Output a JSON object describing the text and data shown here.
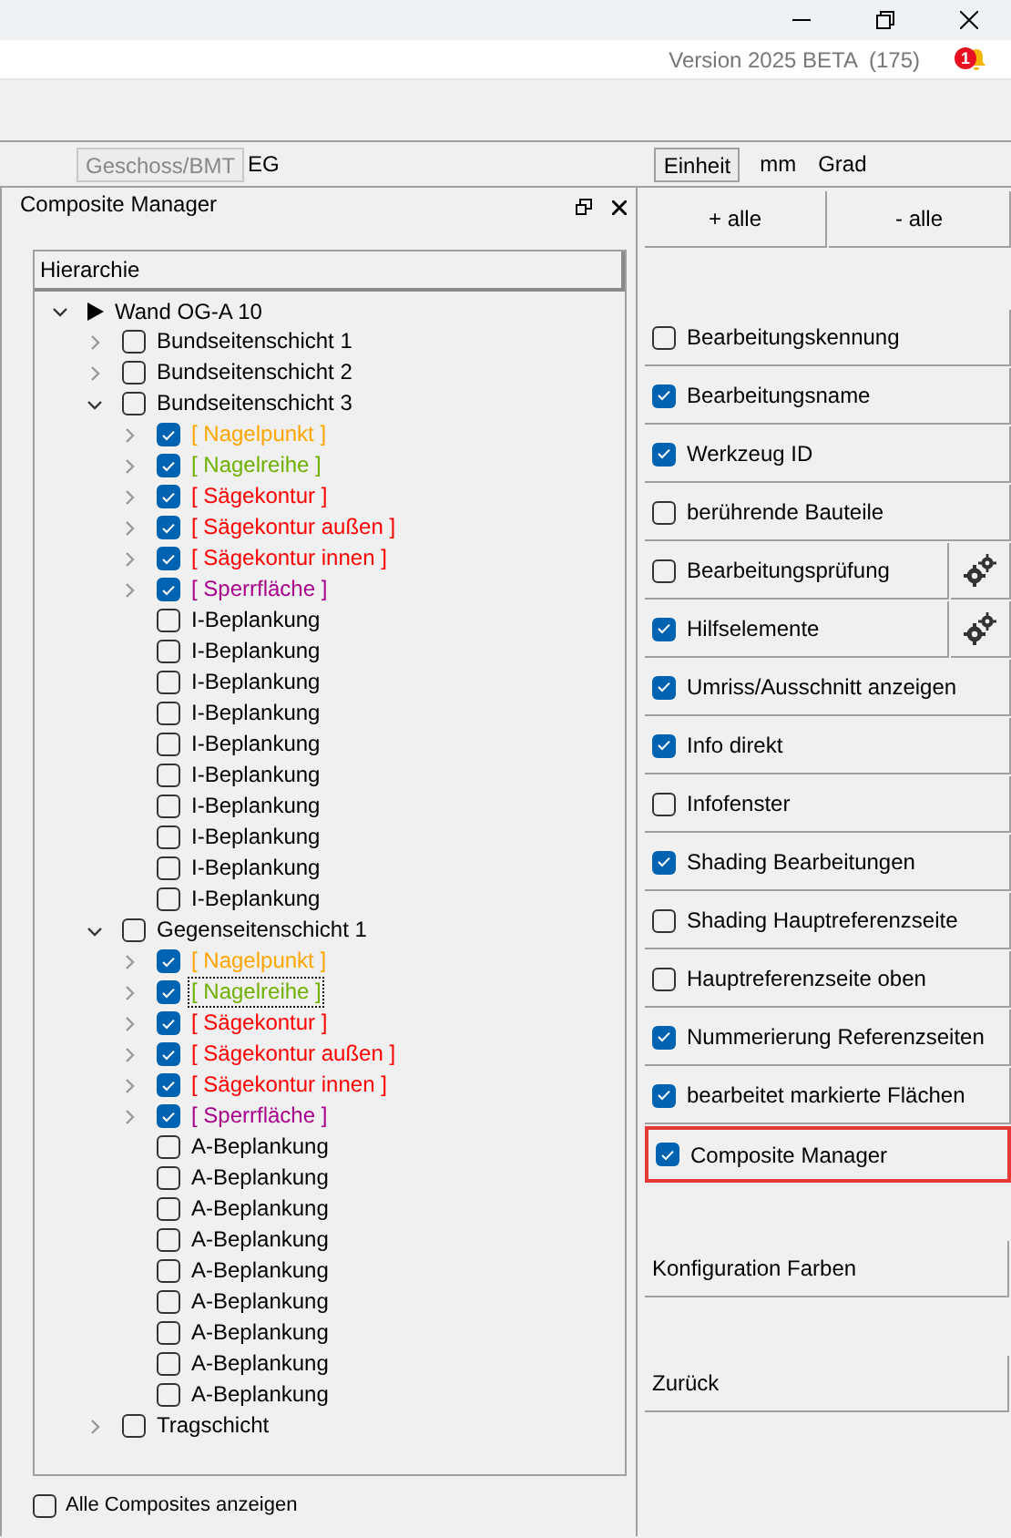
{
  "header": {
    "version": "Version 2025 BETA  (175)",
    "notification_count": "1"
  },
  "toolbar": {
    "floor_button": "Geschoss/BMT",
    "floor_value": "EG",
    "unit_button": "Einheit",
    "unit_length": "mm",
    "unit_angle": "Grad"
  },
  "composite_manager": {
    "title": "Composite Manager",
    "column_header": "Hierarchie",
    "tree": {
      "label": "Wand OG-A 10",
      "expanded": true,
      "children": [
        {
          "label": "Bundseitenschicht 1",
          "checked": false,
          "expanded": false
        },
        {
          "label": "Bundseitenschicht 2",
          "checked": false,
          "expanded": false
        },
        {
          "label": "Bundseitenschicht 3",
          "checked": false,
          "expanded": true,
          "children": [
            {
              "label": "[ Nagelpunkt ]",
              "checked": true,
              "expanded": false,
              "color": "#ffa500",
              "focused": false
            },
            {
              "label": "[ Nagelreihe ]",
              "checked": true,
              "expanded": false,
              "color": "#6fb000",
              "focused": false
            },
            {
              "label": "[ Sägekontur ]",
              "checked": true,
              "expanded": false,
              "color": "#ff0000",
              "focused": false
            },
            {
              "label": "[ Sägekontur außen ]",
              "checked": true,
              "expanded": false,
              "color": "#ff0000",
              "focused": false
            },
            {
              "label": "[ Sägekontur innen ]",
              "checked": true,
              "expanded": false,
              "color": "#ff0000",
              "focused": false
            },
            {
              "label": "[ Sperrfläche ]",
              "checked": true,
              "expanded": false,
              "color": "#a8008c",
              "focused": false
            },
            {
              "label": "I-Beplankung",
              "checked": false,
              "focused": false
            },
            {
              "label": "I-Beplankung",
              "checked": false,
              "focused": false
            },
            {
              "label": "I-Beplankung",
              "checked": false,
              "focused": false
            },
            {
              "label": "I-Beplankung",
              "checked": false,
              "focused": false
            },
            {
              "label": "I-Beplankung",
              "checked": false,
              "focused": false
            },
            {
              "label": "I-Beplankung",
              "checked": false,
              "focused": false
            },
            {
              "label": "I-Beplankung",
              "checked": false,
              "focused": false
            },
            {
              "label": "I-Beplankung",
              "checked": false,
              "focused": false
            },
            {
              "label": "I-Beplankung",
              "checked": false,
              "focused": false
            },
            {
              "label": "I-Beplankung",
              "checked": false,
              "focused": false
            }
          ]
        },
        {
          "label": "Gegenseitenschicht 1",
          "checked": false,
          "expanded": true,
          "children": [
            {
              "label": "[ Nagelpunkt ]",
              "checked": true,
              "expanded": false,
              "color": "#ffa500",
              "focused": false
            },
            {
              "label": "[ Nagelreihe ]",
              "checked": true,
              "expanded": false,
              "color": "#6fb000",
              "focused": true
            },
            {
              "label": "[ Sägekontur ]",
              "checked": true,
              "expanded": false,
              "color": "#ff0000",
              "focused": false
            },
            {
              "label": "[ Sägekontur außen ]",
              "checked": true,
              "expanded": false,
              "color": "#ff0000",
              "focused": false
            },
            {
              "label": "[ Sägekontur innen ]",
              "checked": true,
              "expanded": false,
              "color": "#ff0000",
              "focused": false
            },
            {
              "label": "[ Sperrfläche ]",
              "checked": true,
              "expanded": false,
              "color": "#a8008c",
              "focused": false
            },
            {
              "label": "A-Beplankung",
              "checked": false,
              "focused": false
            },
            {
              "label": "A-Beplankung",
              "checked": false,
              "focused": false
            },
            {
              "label": "A-Beplankung",
              "checked": false,
              "focused": false
            },
            {
              "label": "A-Beplankung",
              "checked": false,
              "focused": false
            },
            {
              "label": "A-Beplankung",
              "checked": false,
              "focused": false
            },
            {
              "label": "A-Beplankung",
              "checked": false,
              "focused": false
            },
            {
              "label": "A-Beplankung",
              "checked": false,
              "focused": false
            },
            {
              "label": "A-Beplankung",
              "checked": false,
              "focused": false
            },
            {
              "label": "A-Beplankung",
              "checked": false,
              "focused": false
            }
          ]
        },
        {
          "label": "Tragschicht",
          "checked": false,
          "expanded": false
        }
      ]
    },
    "show_all": {
      "label": "Alle Composites anzeigen",
      "checked": false
    }
  },
  "bulk_buttons": [
    "+ alle",
    "- alle"
  ],
  "options": [
    {
      "label": "Bearbeitungskennung",
      "checked": false,
      "kind": "plain",
      "highlighted": false
    },
    {
      "label": "Bearbeitungsname",
      "checked": true,
      "kind": "plain",
      "highlighted": false
    },
    {
      "label": "Werkzeug ID",
      "checked": true,
      "kind": "plain",
      "highlighted": false
    },
    {
      "label": "berührende Bauteile",
      "checked": false,
      "kind": "plain",
      "highlighted": false
    },
    {
      "label": "Bearbeitungsprüfung",
      "checked": false,
      "kind": "settings",
      "highlighted": false
    },
    {
      "label": "Hilfselemente",
      "checked": true,
      "kind": "settings",
      "highlighted": false
    },
    {
      "label": "Umriss/Ausschnitt anzeigen",
      "checked": true,
      "kind": "plain",
      "highlighted": false
    },
    {
      "label": "Info direkt",
      "checked": true,
      "kind": "plain",
      "highlighted": false
    },
    {
      "label": "Infofenster",
      "checked": false,
      "kind": "plain",
      "highlighted": false
    },
    {
      "label": "Shading Bearbeitungen",
      "checked": true,
      "kind": "plain",
      "highlighted": false
    },
    {
      "label": "Shading Hauptreferenzseite",
      "checked": false,
      "kind": "plain",
      "highlighted": false
    },
    {
      "label": "Hauptreferenzseite oben",
      "checked": false,
      "kind": "plain",
      "highlighted": false
    },
    {
      "label": "Nummerierung Referenzseiten",
      "checked": true,
      "kind": "plain",
      "highlighted": false
    },
    {
      "label": "bearbeitet markierte Flächen",
      "checked": true,
      "kind": "plain",
      "highlighted": false
    },
    {
      "label": "Composite Manager",
      "checked": true,
      "kind": "plain",
      "highlighted": true
    }
  ],
  "bottom_buttons": [
    "Konfiguration Farben",
    "Zurück"
  ]
}
